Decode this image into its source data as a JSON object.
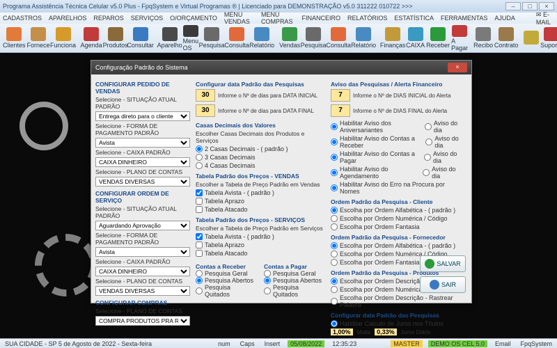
{
  "title": "Programa Assistência Técnica Celular v5.0 Plus - FpqSystem e Virtual Programas ® | Licenciado para  DEMONSTRAÇÃO v5.0 311222 010722 >>>",
  "menu": [
    "CADASTROS",
    "APARELHOS",
    "REPAROS",
    "SERVIÇOS",
    "O/ORÇAMENTO",
    "MENU VENDAS",
    "MENU COMPRAS",
    "FINANCEIRO",
    "RELATÓRIOS",
    "ESTATÍSTICA",
    "FERRAMENTAS",
    "AJUDA"
  ],
  "email_label": "E-MAIL",
  "toolbar": [
    {
      "label": "Clientes",
      "c": "#e27a3a"
    },
    {
      "label": "Fornece",
      "c": "#c38f4a"
    },
    {
      "label": "Funciona",
      "c": "#d69a2a"
    },
    {
      "label": "Agenda",
      "c": "#c23a3a"
    },
    {
      "label": "Produtos",
      "c": "#8a6a3a"
    },
    {
      "label": "Consultar",
      "c": "#3a7ac2"
    },
    {
      "label": "Aparelho",
      "c": "#4a4a4a"
    },
    {
      "label": "Menu OS",
      "c": "#3a3a3a"
    },
    {
      "label": "Pesquisa",
      "c": "#6a6a6a"
    },
    {
      "label": "Consulta",
      "c": "#e26a3a"
    },
    {
      "label": "Relatório",
      "c": "#4a8ac2"
    },
    {
      "label": "Vendas",
      "c": "#3a9a4a"
    },
    {
      "label": "Pesquisa",
      "c": "#6a6a6a"
    },
    {
      "label": "Consulta",
      "c": "#e26a3a"
    },
    {
      "label": "Relatório",
      "c": "#4a8ac2"
    },
    {
      "label": "Finanças",
      "c": "#c29a3a"
    },
    {
      "label": "CAIXA",
      "c": "#3a9ac2"
    },
    {
      "label": "Receber",
      "c": "#2a9a3a"
    },
    {
      "label": "A Pagar",
      "c": "#c23a3a"
    },
    {
      "label": "Recibo",
      "c": "#7a7a7a"
    },
    {
      "label": "Contrato",
      "c": "#9a7a4a"
    },
    {
      "label": "",
      "c": "#c2aa3a"
    },
    {
      "label": "Suporte",
      "c": "#c23a3a"
    }
  ],
  "dialog": {
    "title": "Configuração Padrão do Sistema",
    "vendas": {
      "header": "CONFIGURAR PEDIDO DE VENDAS",
      "l1": "Selecione - SITUAÇÃO ATUAL PADRÃO",
      "v1": "Entrega direto para o cliente",
      "l2": "Selecione - FORMA DE PAGAMENTO PADRÃO",
      "v2": "Avista",
      "l3": "Selecione - CAIXA PADRÃO",
      "v3": "CAIXA DINHEIRO",
      "l4": "Selecione - PLANO DE CONTAS",
      "v4": "VENDAS DIVERSAS"
    },
    "os": {
      "header": "CONFIGURAR ORDEM DE SERVIÇO",
      "l1": "Selecione - SITUAÇÃO ATUAL PADRÃO",
      "v1": "Aguardando Aprovação",
      "l2": "Selecione - FORMA DE PAGAMENTO PADRÃO",
      "v2": "Avista",
      "l3": "Selecione - CAIXA PADRÃO",
      "v3": "CAIXA DINHEIRO",
      "l4": "Selecione - PLANO DE CONTAS",
      "v4": "VENDAS DIVERSAS"
    },
    "compras": {
      "header": "CONFIGURAR COMPRAS",
      "l1": "Selecione - PLANO DE CONTAS",
      "v1": "COMPRA PRODUTOS PRA REVENDA"
    },
    "pesqdata": {
      "header": "Configurar data Padrão das Pesquisas",
      "n1": "30",
      "t1": "Informe o Nº de dias para DATA INICIAL",
      "n2": "30",
      "t2": "Informe o Nº de dias para DATA FINAL"
    },
    "casas": {
      "header": "Casas Decimais dos Valores",
      "sub": "Escolher Casas Decimais dos Produtos e Serviços",
      "o1": "2 Casas Decimais - ( padrão )",
      "o2": "3 Casas Decimais",
      "o3": "4 Casas Decimais"
    },
    "tpv": {
      "header": "Tabela Padrão dos Preços - VENDAS",
      "sub": "Escolher a Tabela de Preço Padrão em Vendas",
      "o1": "Tabela Avista - ( padrão )",
      "o2": "Tabela Aprazo",
      "o3": "Tabela Atacado"
    },
    "tps": {
      "header": "Tabela Padrão dos Preços - SERVIÇOS",
      "sub": "Escolher a Tabela de Preço Padrão em Serviços",
      "o1": "Tabela Avista - ( padrão )",
      "o2": "Tabela Aprazo",
      "o3": "Tabela Atacado"
    },
    "contas": {
      "h1": "Contas a Receber",
      "h2": "Contas a Pagar",
      "o1": "Pesquisa Geral",
      "o2": "Pesquisa Abertos",
      "o3": "Pesquisa Quitados"
    },
    "alerta": {
      "header": "Aviso das Pesquisas / Alerta Financeiro",
      "n1": "7",
      "t1": "Informe o Nº de DIAS INICIAL do Alerta",
      "n2": "7",
      "t2": "Informe o Nº de DIAS FINAL do Alerta",
      "r1": "Habilitar Aviso dos Aniversariantes",
      "rd": "Aviso do dia",
      "r2": "Habilitar Aviso do Contas a Receber",
      "r3": "Habilitar Aviso do Contas a Pagar",
      "r4": "Habilitar Aviso do Agendamento",
      "r5": "Habilitar Aviso do Erro na Procura por Nomes"
    },
    "opc": {
      "header": "Ordem Padrão da Pesquisa - Cliente",
      "o1": "Escolha por Ordem Alfabética - ( padrão )",
      "o2": "Escolha por Ordem Numérica / Código",
      "o3": "Escolha por Ordem Fantasia"
    },
    "opf": {
      "header": "Ordem Padrão da Pesquisa - Fornecedor",
      "o1": "Escolha por Ordem Alfabética - ( padrão )",
      "o2": "Escolha por Ordem Numérica / Código",
      "o3": "Escolha por Ordem Fantasia"
    },
    "opp": {
      "header": "Ordem Padrão da Pesquisa - Produtos",
      "o1": "Escolha por Ordem Descrição - ( padrão )",
      "o2": "Escolha por Ordem Numérica / Código",
      "o3": "Escolha por Ordem Descrição - Rastrear Palavra"
    },
    "juros": {
      "header": "Configurar data Padrão das Pesquisas",
      "o1": "Habilitar Calculo de Juros nos Títulos",
      "v1": "1,00%",
      "l1": "Multa",
      "v2": "0,33%",
      "l2": "Juros Diário"
    },
    "btn_save": "SALVAR",
    "btn_exit": "SAIR"
  },
  "status": {
    "loc": "SUA CIDADE - SP  5 de Agosto de 2022 - Sexta-feira",
    "num": "num",
    "caps": "Caps",
    "insert": "Insert",
    "date": "05/08/2022",
    "time": "12:35:23",
    "master": "MASTER",
    "demo": "DEMO OS CEL 5.0",
    "email": "Email",
    "brand": "FpqSystem"
  }
}
